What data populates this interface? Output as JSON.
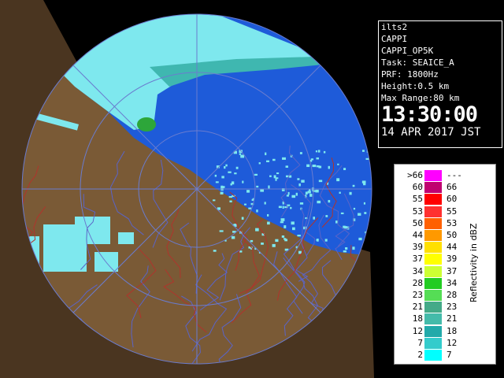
{
  "info": {
    "site": "ilts2",
    "product": "CAPPI",
    "product_code": "CAPPI_OP5K",
    "task": "Task: SEAICE_A",
    "prf": "PRF: 1800Hz",
    "height": "Height:0.5 km",
    "max_range": "Max Range:80 km",
    "time": "13:30:00",
    "date": "14 APR 2017 JST"
  },
  "legend": {
    "units_label": "Reflectivity in dBZ",
    "rows": [
      {
        "lo": ">66",
        "hi": "---",
        "color": "#ff00ff"
      },
      {
        "lo": "60",
        "hi": "66",
        "color": "#c00070"
      },
      {
        "lo": "55",
        "hi": "60",
        "color": "#ff0000"
      },
      {
        "lo": "53",
        "hi": "55",
        "color": "#ff3030"
      },
      {
        "lo": "50",
        "hi": "53",
        "color": "#ff6000"
      },
      {
        "lo": "44",
        "hi": "50",
        "color": "#ff9900"
      },
      {
        "lo": "39",
        "hi": "44",
        "color": "#ffe000"
      },
      {
        "lo": "37",
        "hi": "39",
        "color": "#ffff00"
      },
      {
        "lo": "34",
        "hi": "37",
        "color": "#ccff33"
      },
      {
        "lo": "28",
        "hi": "34",
        "color": "#22cc22"
      },
      {
        "lo": "23",
        "hi": "28",
        "color": "#55dd55"
      },
      {
        "lo": "21",
        "hi": "23",
        "color": "#44aa88"
      },
      {
        "lo": "18",
        "hi": "21",
        "color": "#44bbaa"
      },
      {
        "lo": "12",
        "hi": "18",
        "color": "#22aaaa"
      },
      {
        "lo": "7",
        "hi": "12",
        "color": "#33cccc"
      },
      {
        "lo": "2",
        "hi": "7",
        "color": "#00ffff"
      }
    ]
  },
  "colors": {
    "sea": "#1e5bd9",
    "land": "#7a5a36",
    "echo_light": "#7ee8ee",
    "echo_mid": "#3fb7b0",
    "echo_strong": "#2da63a",
    "rivers": "#5a64c8",
    "borders": "#b0342c",
    "range_rings": "#6a7ccf"
  }
}
